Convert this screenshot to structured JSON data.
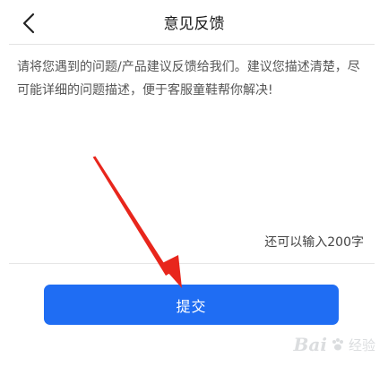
{
  "header": {
    "title": "意见反馈",
    "back_icon": "chevron-left-icon"
  },
  "feedback": {
    "placeholder": "请将您遇到的问题/产品建议反馈给我们。建议您描述清楚，尽可能详细的问题描述，便于客服童鞋帮你解决!",
    "value": "",
    "counter_text": "还可以输入200字"
  },
  "submit": {
    "label": "提交"
  },
  "annotation": {
    "arrow_color": "#e8261c"
  },
  "watermark": {
    "logo_text": "Bai",
    "suffix_text": "经验"
  },
  "colors": {
    "accent": "#1f6df3",
    "divider": "#e3e3e3"
  }
}
